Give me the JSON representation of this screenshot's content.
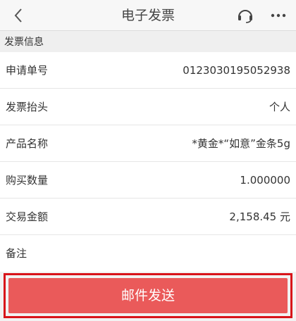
{
  "nav": {
    "title": "电子发票",
    "icons": {
      "back": "back-chevron-icon",
      "service": "headset-icon",
      "more": "more-dots-icon"
    }
  },
  "section": {
    "title": "发票信息"
  },
  "rows": [
    {
      "label": "申请单号",
      "value": "0123030195052938"
    },
    {
      "label": "发票抬头",
      "value": "个人"
    },
    {
      "label": "产品名称",
      "value": "*黄金*“如意”金条5g"
    },
    {
      "label": "购买数量",
      "value": "1.000000"
    },
    {
      "label": "交易金额",
      "value": "2,158.45 元"
    },
    {
      "label": "备注",
      "value": ""
    }
  ],
  "action": {
    "send_label": "邮件发送"
  },
  "colors": {
    "accent": "#ea5a5a",
    "highlight": "#d8141a"
  }
}
